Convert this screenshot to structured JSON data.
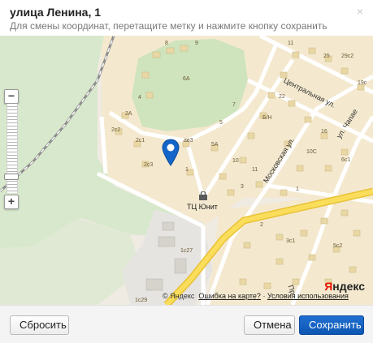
{
  "dialog": {
    "title": "улица Ленина, 1",
    "subtitle": "Для смены координат, перетащите метку и нажмите кнопку сохранить",
    "close_label": "×"
  },
  "map": {
    "zoom_in_label": "+",
    "zoom_out_label": "−",
    "zoom_level_fraction": 0.83,
    "street_labels": {
      "central": "Центральная ул.",
      "moscow": "Московская ул.",
      "chapaev": "ул. Чапае",
      "bottom_right": "Пр"
    },
    "poi_label": "ТЦ Юнит",
    "house_numbers": {
      "h1": "8",
      "h2": "9",
      "h3": "11",
      "h4": "25",
      "h5": "29с2",
      "h6": "6А",
      "h7": "4",
      "h8": "2А",
      "h9": "2с2",
      "h10": "2с1",
      "h11": "2с3",
      "h12": "ав3",
      "h13": "1",
      "h14": "7",
      "h15": "5",
      "h16": "5А",
      "h17": "Б/Н",
      "h18": "22",
      "h19": "10С",
      "h20": "6с1",
      "h21": "19с",
      "h22": "16",
      "h23": "10",
      "h24": "11",
      "h25": "3",
      "h26": "1",
      "h27": "2",
      "h28": "3с1",
      "h29": "5с2",
      "h30": "1с27",
      "h31": "1с29"
    },
    "copyright": "© Яндекс",
    "error_link": "Ошибка на карте?",
    "terms_link": "Условия использования",
    "separator": "·",
    "logo": {
      "first_letter": "Я",
      "rest": "ндекс"
    }
  },
  "footer": {
    "reset_label": "Сбросить",
    "cancel_label": "Отмена",
    "save_label": "Сохранить"
  }
}
